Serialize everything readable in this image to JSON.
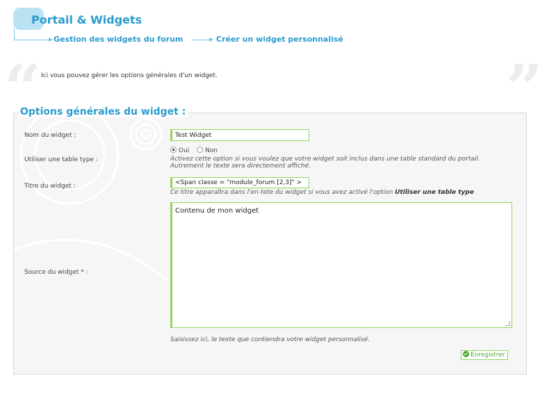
{
  "header": {
    "title": "Portail & Widgets",
    "breadcrumb": [
      "Gestion des widgets du forum",
      "Créer un widget personnalisé"
    ]
  },
  "intro": {
    "text": "Ici vous pouvez gérer les options générales d'un widget.",
    "quote_open": "“",
    "quote_close": "”"
  },
  "form": {
    "legend": "Options générales du widget :",
    "widget_name": {
      "label": "Nom du widget :",
      "value": "Test Widget"
    },
    "use_table": {
      "label": "Utiliser une table type :",
      "options": [
        "Oui",
        "Non"
      ],
      "selected": "Oui",
      "hint_line1": "Activez cette option si vous voulez que votre widget soit inclus dans une table standard du portail.",
      "hint_line2": "Autrement le texte sera directement affiché."
    },
    "widget_title": {
      "label": "Titre du widget :",
      "value": "<Span  classe = \"module_forum [2,3]\" >",
      "hint_prefix": "Ce titre apparaîtra dans l'en-tete du widget si vous avez activé l'option ",
      "hint_bold": "Utiliser une table type"
    },
    "widget_source": {
      "label": "Source du widget * :",
      "value": "Contenu de mon widget",
      "hint": "Saisissez ici, le texte que contiendra votre widget personnalisé."
    },
    "save_label": "Enregistrer"
  },
  "colors": {
    "accent_blue": "#2a9bcf",
    "accent_green": "#8fd65a",
    "panel_bg": "#f6f6f6"
  }
}
